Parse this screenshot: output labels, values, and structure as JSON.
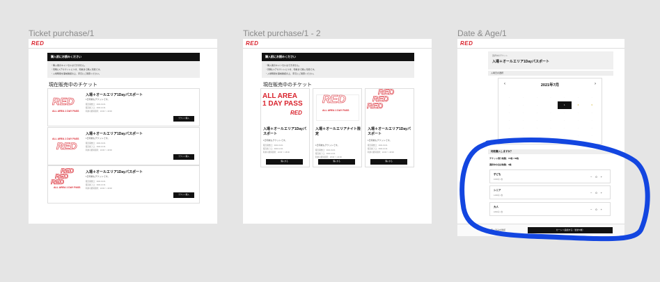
{
  "frames": {
    "f1_label": "Ticket purchase/1",
    "f2_label": "Ticket purchase/1 - 2",
    "f3_label": "Date & Age/1"
  },
  "logo_text": "RED",
  "f1": {
    "notice_title": "購入前にお読みください",
    "notice_lines": [
      "・購入後のキャンセルはできません。",
      "・同時に1アカウントにつき、何枚まで購入可能です。",
      "・入場時間を事前確認の上、手元にご用意ください。"
    ],
    "section_title": "現在販売中のチケット",
    "tickets": [
      {
        "title": "入場＋オールエリア1Dayパスポート",
        "sub": "1日何枚もチケットです。",
        "meta1": "販売開始日：2021.01.01",
        "meta2": "販売終了日：2021.12.31",
        "meta3": "利用可能時間帯：10:00 〜 18:00",
        "caption": "ALL AREA 1 DAY PASS",
        "btn": "チケット購入"
      },
      {
        "title": "入場＋オールエリア1Dayパスポート",
        "sub": "1日何枚もチケットです。",
        "meta1": "販売開始日：2021.01.01",
        "meta2": "販売終了日：2021.12.31",
        "meta3": "利用可能時間帯：10:00 〜 18:00",
        "caption": "ALL AREA 1 DAY PASS",
        "btn": "チケット購入"
      },
      {
        "title": "入場＋オールエリア1Dayパスポート",
        "sub": "1日何枚もチケットです。",
        "meta1": "販売開始日：2021.01.01",
        "meta2": "販売終了日：2021.12.31",
        "meta3": "利用可能時間帯：10:00 〜 18:00",
        "caption": "ALL AREA 1 DAY PASS",
        "btn": "チケット購入"
      }
    ]
  },
  "f2": {
    "notice_title": "購入前にお読みください",
    "notice_lines": [
      "・購入後のキャンセルはできません。",
      "・同時に1アカウントにつき、何枚まで購入可能です。",
      "・入場時間を事前確認の上、手元にご用意ください。"
    ],
    "section_title": "現在販売中のチケット",
    "all_area": "ALL AREA",
    "day_pass": "1 DAY PASS",
    "caption": "ALL AREA 1 DAY PASS",
    "cards": [
      {
        "title": "入場＋オールエリア1Dayパスポート",
        "sub": "1日何枚もチケットです。",
        "meta1": "販売開始日：2021.01.01",
        "meta2": "販売終了日：2021.12.31",
        "meta3": "利用可能時間帯：10:00 〜 18:00",
        "btn": "購入する"
      },
      {
        "title": "入場＋オールエリアナイト限定",
        "sub": "1日何枚もチケットです。",
        "meta1": "販売開始日：2021.01.01",
        "meta2": "販売終了日：2021.12.31",
        "meta3": "利用可能時間帯：18:00 〜 22:00",
        "btn": "購入する"
      },
      {
        "title": "入場＋オールエリア1Dayパスポート",
        "sub": "1日何枚もチケットです。",
        "meta1": "販売開始日：2021.01.01",
        "meta2": "販売終了日：2021.12.31",
        "meta3": "利用可能時間帯：10:00 〜 18:00",
        "btn": "購入する"
      }
    ]
  },
  "f3": {
    "selected_label": "選択中のチケット",
    "selected_ticket": "入場＋オールエリア1Dayパスポート",
    "date_section": "入場日の選択",
    "month": "2021年7月",
    "prev": "‹",
    "next": "›",
    "cal_days": [
      "",
      "",
      "",
      "",
      "",
      "",
      "",
      "",
      "",
      "",
      "",
      "1",
      "2",
      "3",
      "",
      "",
      "",
      "",
      "",
      "",
      "",
      "",
      "",
      "",
      "",
      "",
      "",
      "",
      "",
      "",
      "",
      "",
      "",
      "",
      "",
      "",
      "",
      "",
      "",
      "",
      "",
      ""
    ],
    "question": "何枚購入しますか？",
    "limit": "チケット残り枚数：15枚 / 60枚",
    "selected_count": "選択中の合計枚数：0枚",
    "rows": [
      {
        "name": "子ども",
        "price": "1000円 / 枚",
        "qty": "0"
      },
      {
        "name": "シニア",
        "price": "1200円 / 枚",
        "qty": "0"
      },
      {
        "name": "大人",
        "price": "1800円 / 枚",
        "qty": "0"
      }
    ],
    "minus": "−",
    "plus": "+",
    "back_btn": "購入済みを確認",
    "next_btn": "カートへ追加する（合計0枚）"
  },
  "annotation_color": "#1346e0",
  "brand_red": "#d9232d"
}
